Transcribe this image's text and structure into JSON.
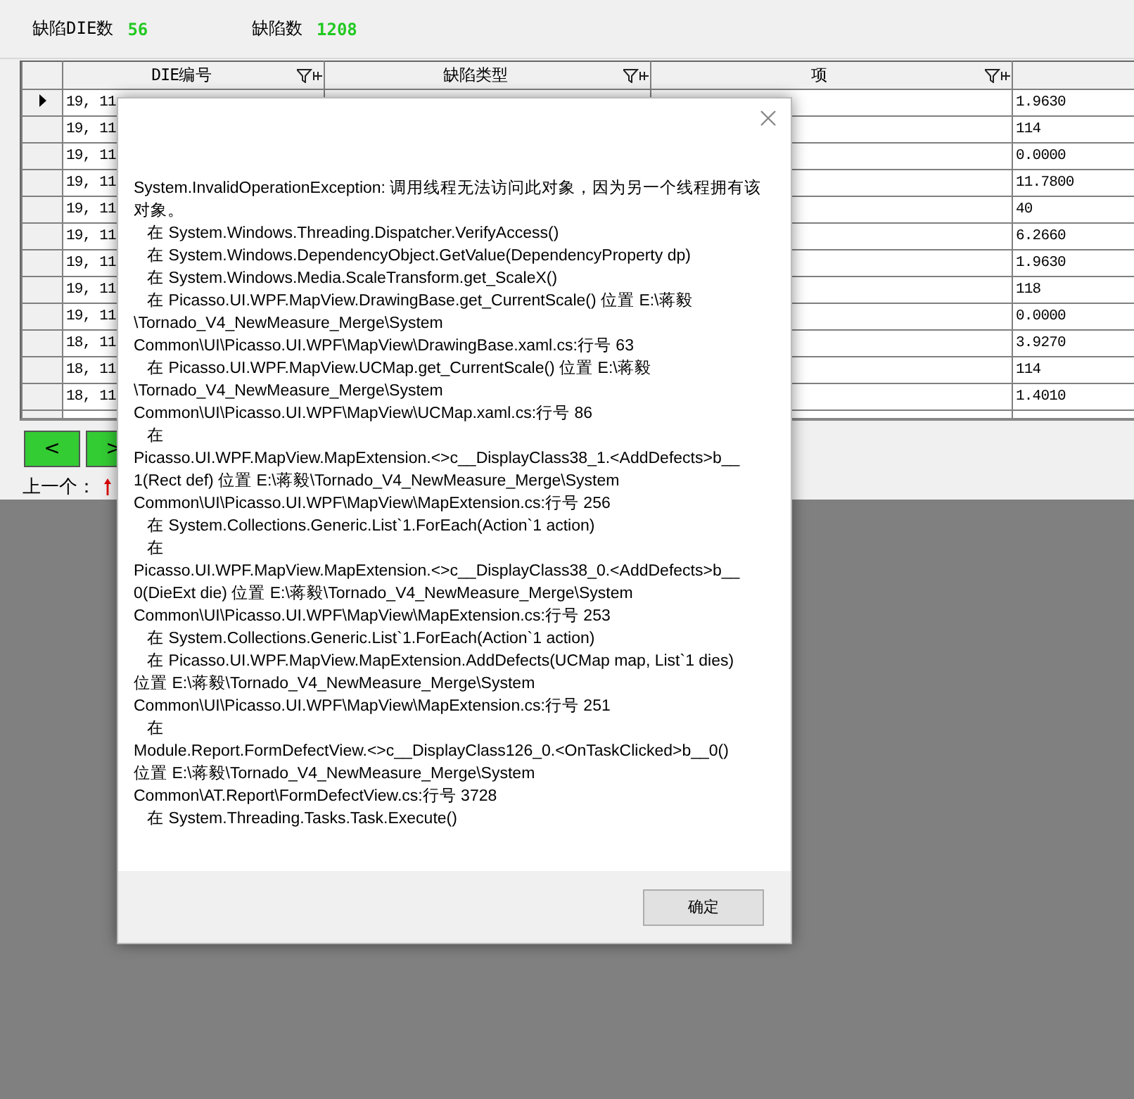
{
  "summary": [
    {
      "label": "缺陷DIE数",
      "value": "56"
    },
    {
      "label": "缺陷数",
      "value": "1208"
    }
  ],
  "table": {
    "columns": [
      {
        "label": "DIE编号"
      },
      {
        "label": "缺陷类型"
      },
      {
        "label": "项"
      }
    ],
    "rows": [
      {
        "current": true,
        "die": "19, 11",
        "value": "1.9630"
      },
      {
        "current": false,
        "die": "19, 11",
        "value": "114"
      },
      {
        "current": false,
        "die": "19, 11",
        "value": "0.0000"
      },
      {
        "current": false,
        "die": "19, 11",
        "value": "11.7800"
      },
      {
        "current": false,
        "die": "19, 11",
        "value": "40"
      },
      {
        "current": false,
        "die": "19, 11",
        "value": "6.2660"
      },
      {
        "current": false,
        "die": "19, 11",
        "value": "1.9630"
      },
      {
        "current": false,
        "die": "19, 11",
        "value": "118"
      },
      {
        "current": false,
        "die": "19, 11",
        "value": "0.0000"
      },
      {
        "current": false,
        "die": "18, 11",
        "value": "3.9270"
      },
      {
        "current": false,
        "die": "18, 11",
        "value": "114"
      },
      {
        "current": false,
        "die": "18, 11",
        "value": "1.4010"
      }
    ]
  },
  "nav": {
    "buttons": [
      {
        "label": "<"
      },
      {
        "label": ">"
      }
    ],
    "prev_label": "上一个："
  },
  "dialog": {
    "lines": [
      "System.InvalidOperationException: 调用线程无法访问此对象，因为另一个线程拥有该",
      "对象。",
      "   在 System.Windows.Threading.Dispatcher.VerifyAccess()",
      "   在 System.Windows.DependencyObject.GetValue(DependencyProperty dp)",
      "   在 System.Windows.Media.ScaleTransform.get_ScaleX()",
      "   在 Picasso.UI.WPF.MapView.DrawingBase.get_CurrentScale() 位置 E:\\蒋毅",
      "\\Tornado_V4_NewMeasure_Merge\\System",
      "Common\\UI\\Picasso.UI.WPF\\MapView\\DrawingBase.xaml.cs:行号 63",
      "   在 Picasso.UI.WPF.MapView.UCMap.get_CurrentScale() 位置 E:\\蒋毅",
      "\\Tornado_V4_NewMeasure_Merge\\System",
      "Common\\UI\\Picasso.UI.WPF\\MapView\\UCMap.xaml.cs:行号 86",
      "   在",
      "Picasso.UI.WPF.MapView.MapExtension.<>c__DisplayClass38_1.<AddDefects>b__",
      "1(Rect def) 位置 E:\\蒋毅\\Tornado_V4_NewMeasure_Merge\\System",
      "Common\\UI\\Picasso.UI.WPF\\MapView\\MapExtension.cs:行号 256",
      "   在 System.Collections.Generic.List`1.ForEach(Action`1 action)",
      "   在",
      "Picasso.UI.WPF.MapView.MapExtension.<>c__DisplayClass38_0.<AddDefects>b__",
      "0(DieExt die) 位置 E:\\蒋毅\\Tornado_V4_NewMeasure_Merge\\System",
      "Common\\UI\\Picasso.UI.WPF\\MapView\\MapExtension.cs:行号 253",
      "   在 System.Collections.Generic.List`1.ForEach(Action`1 action)",
      "   在 Picasso.UI.WPF.MapView.MapExtension.AddDefects(UCMap map, List`1 dies)",
      "位置 E:\\蒋毅\\Tornado_V4_NewMeasure_Merge\\System",
      "Common\\UI\\Picasso.UI.WPF\\MapView\\MapExtension.cs:行号 251",
      "   在",
      "Module.Report.FormDefectView.<>c__DisplayClass126_0.<OnTaskClicked>b__0()",
      "位置 E:\\蒋毅\\Tornado_V4_NewMeasure_Merge\\System",
      "Common\\AT.Report\\FormDefectView.cs:行号 3728",
      "   在 System.Threading.Tasks.Task.Execute()"
    ],
    "ok": "确定"
  }
}
